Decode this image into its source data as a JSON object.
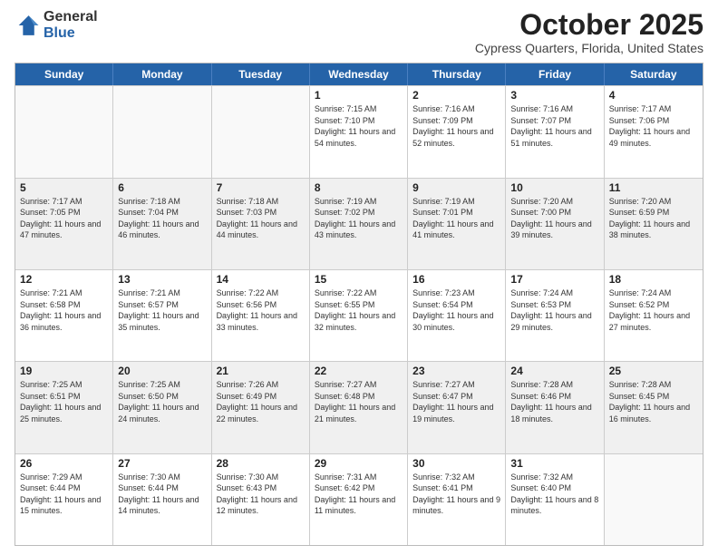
{
  "logo": {
    "general": "General",
    "blue": "Blue"
  },
  "header": {
    "month": "October 2025",
    "location": "Cypress Quarters, Florida, United States"
  },
  "weekdays": [
    "Sunday",
    "Monday",
    "Tuesday",
    "Wednesday",
    "Thursday",
    "Friday",
    "Saturday"
  ],
  "rows": [
    [
      {
        "day": "",
        "sunrise": "",
        "sunset": "",
        "daylight": "",
        "empty": true
      },
      {
        "day": "",
        "sunrise": "",
        "sunset": "",
        "daylight": "",
        "empty": true
      },
      {
        "day": "",
        "sunrise": "",
        "sunset": "",
        "daylight": "",
        "empty": true
      },
      {
        "day": "1",
        "sunrise": "Sunrise: 7:15 AM",
        "sunset": "Sunset: 7:10 PM",
        "daylight": "Daylight: 11 hours and 54 minutes.",
        "empty": false
      },
      {
        "day": "2",
        "sunrise": "Sunrise: 7:16 AM",
        "sunset": "Sunset: 7:09 PM",
        "daylight": "Daylight: 11 hours and 52 minutes.",
        "empty": false
      },
      {
        "day": "3",
        "sunrise": "Sunrise: 7:16 AM",
        "sunset": "Sunset: 7:07 PM",
        "daylight": "Daylight: 11 hours and 51 minutes.",
        "empty": false
      },
      {
        "day": "4",
        "sunrise": "Sunrise: 7:17 AM",
        "sunset": "Sunset: 7:06 PM",
        "daylight": "Daylight: 11 hours and 49 minutes.",
        "empty": false
      }
    ],
    [
      {
        "day": "5",
        "sunrise": "Sunrise: 7:17 AM",
        "sunset": "Sunset: 7:05 PM",
        "daylight": "Daylight: 11 hours and 47 minutes.",
        "empty": false
      },
      {
        "day": "6",
        "sunrise": "Sunrise: 7:18 AM",
        "sunset": "Sunset: 7:04 PM",
        "daylight": "Daylight: 11 hours and 46 minutes.",
        "empty": false
      },
      {
        "day": "7",
        "sunrise": "Sunrise: 7:18 AM",
        "sunset": "Sunset: 7:03 PM",
        "daylight": "Daylight: 11 hours and 44 minutes.",
        "empty": false
      },
      {
        "day": "8",
        "sunrise": "Sunrise: 7:19 AM",
        "sunset": "Sunset: 7:02 PM",
        "daylight": "Daylight: 11 hours and 43 minutes.",
        "empty": false
      },
      {
        "day": "9",
        "sunrise": "Sunrise: 7:19 AM",
        "sunset": "Sunset: 7:01 PM",
        "daylight": "Daylight: 11 hours and 41 minutes.",
        "empty": false
      },
      {
        "day": "10",
        "sunrise": "Sunrise: 7:20 AM",
        "sunset": "Sunset: 7:00 PM",
        "daylight": "Daylight: 11 hours and 39 minutes.",
        "empty": false
      },
      {
        "day": "11",
        "sunrise": "Sunrise: 7:20 AM",
        "sunset": "Sunset: 6:59 PM",
        "daylight": "Daylight: 11 hours and 38 minutes.",
        "empty": false
      }
    ],
    [
      {
        "day": "12",
        "sunrise": "Sunrise: 7:21 AM",
        "sunset": "Sunset: 6:58 PM",
        "daylight": "Daylight: 11 hours and 36 minutes.",
        "empty": false
      },
      {
        "day": "13",
        "sunrise": "Sunrise: 7:21 AM",
        "sunset": "Sunset: 6:57 PM",
        "daylight": "Daylight: 11 hours and 35 minutes.",
        "empty": false
      },
      {
        "day": "14",
        "sunrise": "Sunrise: 7:22 AM",
        "sunset": "Sunset: 6:56 PM",
        "daylight": "Daylight: 11 hours and 33 minutes.",
        "empty": false
      },
      {
        "day": "15",
        "sunrise": "Sunrise: 7:22 AM",
        "sunset": "Sunset: 6:55 PM",
        "daylight": "Daylight: 11 hours and 32 minutes.",
        "empty": false
      },
      {
        "day": "16",
        "sunrise": "Sunrise: 7:23 AM",
        "sunset": "Sunset: 6:54 PM",
        "daylight": "Daylight: 11 hours and 30 minutes.",
        "empty": false
      },
      {
        "day": "17",
        "sunrise": "Sunrise: 7:24 AM",
        "sunset": "Sunset: 6:53 PM",
        "daylight": "Daylight: 11 hours and 29 minutes.",
        "empty": false
      },
      {
        "day": "18",
        "sunrise": "Sunrise: 7:24 AM",
        "sunset": "Sunset: 6:52 PM",
        "daylight": "Daylight: 11 hours and 27 minutes.",
        "empty": false
      }
    ],
    [
      {
        "day": "19",
        "sunrise": "Sunrise: 7:25 AM",
        "sunset": "Sunset: 6:51 PM",
        "daylight": "Daylight: 11 hours and 25 minutes.",
        "empty": false
      },
      {
        "day": "20",
        "sunrise": "Sunrise: 7:25 AM",
        "sunset": "Sunset: 6:50 PM",
        "daylight": "Daylight: 11 hours and 24 minutes.",
        "empty": false
      },
      {
        "day": "21",
        "sunrise": "Sunrise: 7:26 AM",
        "sunset": "Sunset: 6:49 PM",
        "daylight": "Daylight: 11 hours and 22 minutes.",
        "empty": false
      },
      {
        "day": "22",
        "sunrise": "Sunrise: 7:27 AM",
        "sunset": "Sunset: 6:48 PM",
        "daylight": "Daylight: 11 hours and 21 minutes.",
        "empty": false
      },
      {
        "day": "23",
        "sunrise": "Sunrise: 7:27 AM",
        "sunset": "Sunset: 6:47 PM",
        "daylight": "Daylight: 11 hours and 19 minutes.",
        "empty": false
      },
      {
        "day": "24",
        "sunrise": "Sunrise: 7:28 AM",
        "sunset": "Sunset: 6:46 PM",
        "daylight": "Daylight: 11 hours and 18 minutes.",
        "empty": false
      },
      {
        "day": "25",
        "sunrise": "Sunrise: 7:28 AM",
        "sunset": "Sunset: 6:45 PM",
        "daylight": "Daylight: 11 hours and 16 minutes.",
        "empty": false
      }
    ],
    [
      {
        "day": "26",
        "sunrise": "Sunrise: 7:29 AM",
        "sunset": "Sunset: 6:44 PM",
        "daylight": "Daylight: 11 hours and 15 minutes.",
        "empty": false
      },
      {
        "day": "27",
        "sunrise": "Sunrise: 7:30 AM",
        "sunset": "Sunset: 6:44 PM",
        "daylight": "Daylight: 11 hours and 14 minutes.",
        "empty": false
      },
      {
        "day": "28",
        "sunrise": "Sunrise: 7:30 AM",
        "sunset": "Sunset: 6:43 PM",
        "daylight": "Daylight: 11 hours and 12 minutes.",
        "empty": false
      },
      {
        "day": "29",
        "sunrise": "Sunrise: 7:31 AM",
        "sunset": "Sunset: 6:42 PM",
        "daylight": "Daylight: 11 hours and 11 minutes.",
        "empty": false
      },
      {
        "day": "30",
        "sunrise": "Sunrise: 7:32 AM",
        "sunset": "Sunset: 6:41 PM",
        "daylight": "Daylight: 11 hours and 9 minutes.",
        "empty": false
      },
      {
        "day": "31",
        "sunrise": "Sunrise: 7:32 AM",
        "sunset": "Sunset: 6:40 PM",
        "daylight": "Daylight: 11 hours and 8 minutes.",
        "empty": false
      },
      {
        "day": "",
        "sunrise": "",
        "sunset": "",
        "daylight": "",
        "empty": true
      }
    ]
  ]
}
